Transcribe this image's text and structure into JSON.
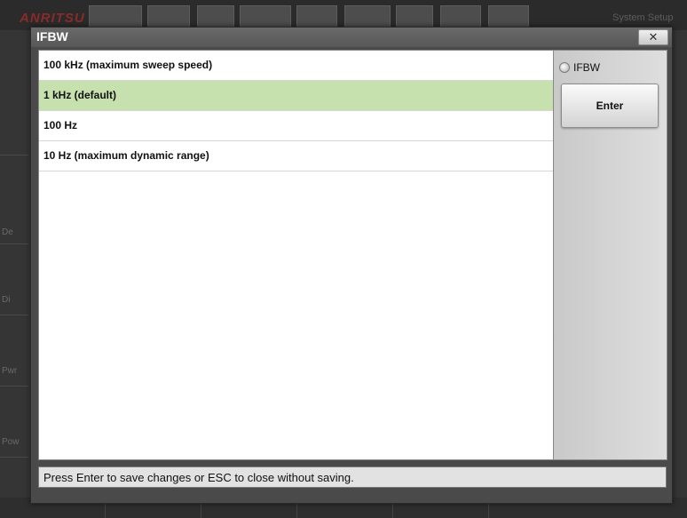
{
  "background": {
    "logo_text": "ANRITSU",
    "setup_label": "System Setup",
    "side_labels": [
      "Pow",
      "Pwr",
      "Di",
      "De"
    ]
  },
  "dialog": {
    "title": "IFBW",
    "close_label": "✕",
    "options": [
      {
        "label": "100 kHz (maximum sweep speed)",
        "selected": false
      },
      {
        "label": "1 kHz (default)",
        "selected": true
      },
      {
        "label": "100 Hz",
        "selected": false
      },
      {
        "label": "10 Hz (maximum dynamic range)",
        "selected": false
      }
    ],
    "side_panel": {
      "radio_label": "IFBW",
      "enter_label": "Enter"
    },
    "status_text": "Press Enter to save changes or ESC to close without saving."
  },
  "colors": {
    "selected_row": "#c6e0ae",
    "title_bar": "#5f5f5f"
  },
  "icons": {
    "close": "close-icon",
    "radio": "radio-button-icon"
  }
}
